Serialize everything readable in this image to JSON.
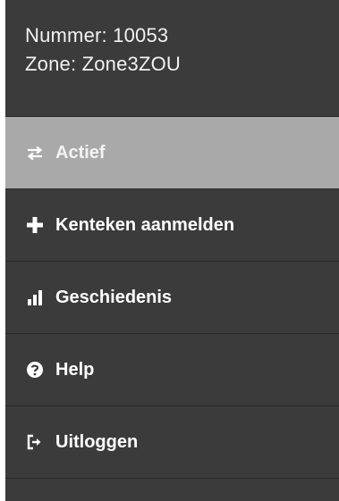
{
  "info": {
    "nummer_line": "Nummer: 10053",
    "zone_line": "Zone: Zone3ZOU"
  },
  "menu": {
    "items": [
      {
        "label": "Actief",
        "icon": "swap-arrows-icon",
        "active": true
      },
      {
        "label": "Kenteken aanmelden",
        "icon": "plus-icon",
        "active": false
      },
      {
        "label": "Geschiedenis",
        "icon": "bar-chart-icon",
        "active": false
      },
      {
        "label": "Help",
        "icon": "question-circle-icon",
        "active": false
      },
      {
        "label": "Uitloggen",
        "icon": "sign-out-icon",
        "active": false
      }
    ]
  },
  "colors": {
    "panel_bg": "#3b3b3b",
    "active_bg": "#a9a9a9",
    "divider": "#2a2a2a",
    "text": "#ffffff"
  }
}
